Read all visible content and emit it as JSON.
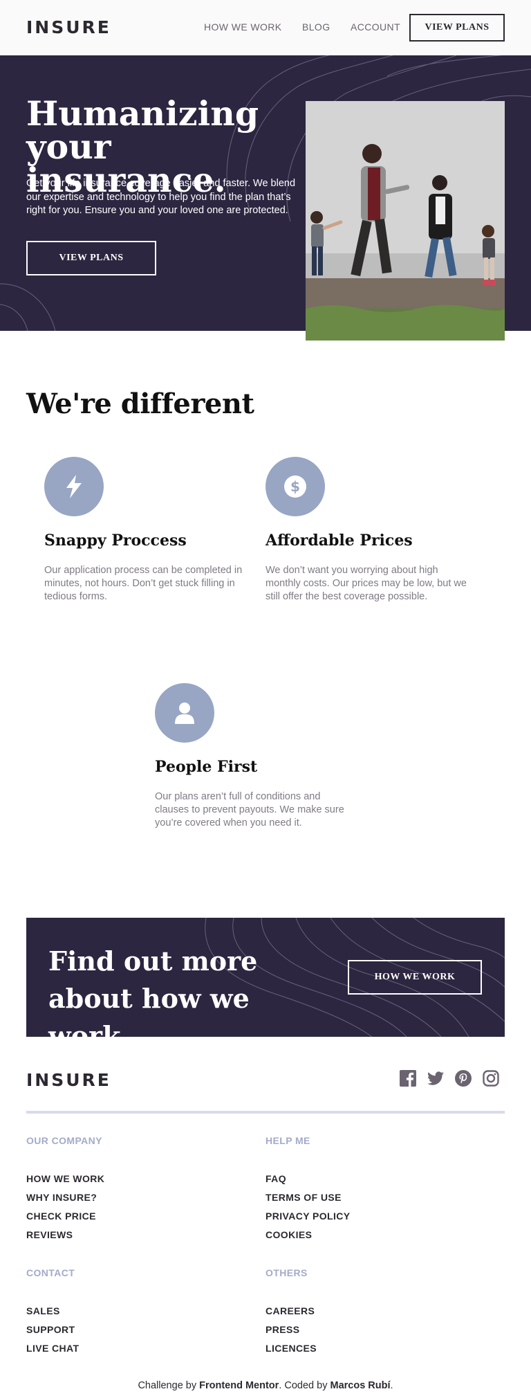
{
  "brand": {
    "logo": "INSURE"
  },
  "nav": {
    "links": [
      "HOW WE WORK",
      "BLOG",
      "ACCOUNT"
    ],
    "cta": "VIEW PLANS"
  },
  "hero": {
    "title": "Humanizing your insurance.",
    "text": "Get your life insurance coverage easier and faster. We blend our expertise and technology to help you find the plan that’s right for you. Ensure you and your loved one are protected.",
    "button": "VIEW PLANS"
  },
  "features": {
    "title": "We're different",
    "items": [
      {
        "icon": "lightning-icon",
        "title": "Snappy Proccess",
        "text": "Our application process can be completed in minutes, not hours. Don’t get stuck filling in tedious forms."
      },
      {
        "icon": "dollar-icon",
        "title": "Affordable Prices",
        "text": "We don’t want you worrying about high monthly costs. Our prices may be low, but we still offer the best coverage possible."
      },
      {
        "icon": "person-icon",
        "title": "People First",
        "text": "Our plans aren’t full of conditions and clauses to prevent payouts. We make sure you’re covered when you need it."
      }
    ]
  },
  "cta": {
    "title": "Find out more about how we work",
    "button": "HOW WE WORK"
  },
  "footer": {
    "logo": "INSURE",
    "social": [
      "facebook-icon",
      "twitter-icon",
      "pinterest-icon",
      "instagram-icon"
    ],
    "columns": [
      {
        "heading": "OUR COMPANY",
        "links": [
          "HOW WE WORK",
          "WHY INSURE?",
          "CHECK PRICE",
          "REVIEWS"
        ]
      },
      {
        "heading": "HELP ME",
        "links": [
          "FAQ",
          "TERMS OF USE",
          "PRIVACY POLICY",
          "COOKIES"
        ]
      },
      {
        "heading": "CONTACT",
        "links": [
          "SALES",
          "SUPPORT",
          "LIVE CHAT"
        ]
      },
      {
        "heading": "OTHERS",
        "links": [
          "CAREERS",
          "PRESS",
          "LICENCES"
        ]
      }
    ],
    "credits": {
      "prefix": "Challenge by ",
      "mentor": "Frontend Mentor",
      "middle": ". Coded by ",
      "author": "Marcos Rubí",
      "suffix": "."
    }
  },
  "colors": {
    "dark_violet": "#2c2640",
    "icon_bg": "#98a6c4",
    "muted_text": "#807a85",
    "footer_heading": "#a3abc9"
  }
}
